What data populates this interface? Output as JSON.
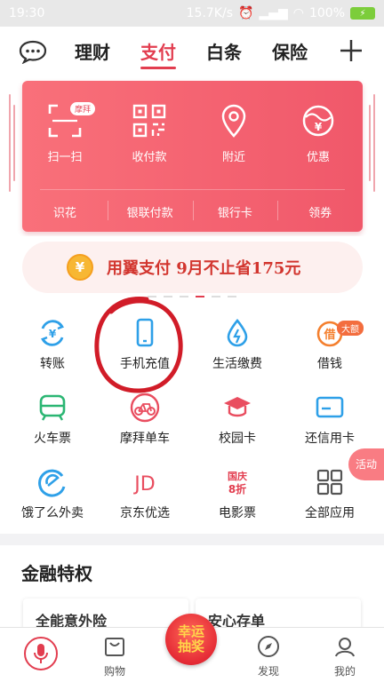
{
  "status_bar": {
    "time": "19:30",
    "network_speed": "15.7K/s",
    "battery": "100%"
  },
  "top_nav": {
    "tabs": [
      {
        "label": "理财",
        "active": false
      },
      {
        "label": "支付",
        "active": true
      },
      {
        "label": "白条",
        "active": false
      },
      {
        "label": "保险",
        "active": false
      }
    ]
  },
  "pay_card": {
    "actions": [
      {
        "label": "扫一扫",
        "icon": "scan-icon",
        "badge": "摩拜"
      },
      {
        "label": "收付款",
        "icon": "qrcode-icon"
      },
      {
        "label": "附近",
        "icon": "location-pin-icon"
      },
      {
        "label": "优惠",
        "icon": "coupon-yen-icon"
      }
    ],
    "sub_actions": [
      "识花",
      "银联付款",
      "银行卡",
      "领券"
    ]
  },
  "promo": {
    "coin_symbol": "¥",
    "text": "用翼支付 9月不止省175元"
  },
  "services": [
    {
      "label": "转账",
      "icon": "transfer-yen-icon",
      "color": "#2ea0e8"
    },
    {
      "label": "手机充值",
      "icon": "mobile-phone-icon",
      "color": "#2ea0e8"
    },
    {
      "label": "生活缴费",
      "icon": "water-drop-icon",
      "color": "#2ea0e8"
    },
    {
      "label": "借钱",
      "icon": "loan-jie-icon",
      "color": "#f47f2e",
      "badge": "大额"
    },
    {
      "label": "火车票",
      "icon": "train-icon",
      "color": "#2bb673"
    },
    {
      "label": "摩拜单车",
      "icon": "bicycle-icon",
      "color": "#e94d5f"
    },
    {
      "label": "校园卡",
      "icon": "graduation-cap-icon",
      "color": "#e94d5f"
    },
    {
      "label": "还信用卡",
      "icon": "credit-card-icon",
      "color": "#2ea0e8"
    },
    {
      "label": "饿了么外卖",
      "icon": "eleme-icon",
      "color": "#2ea0e8"
    },
    {
      "label": "京东优选",
      "icon": "jd-logo-icon",
      "color": "#e94d5f",
      "glyph": "JD"
    },
    {
      "label": "电影票",
      "icon": "national-day-discount-icon",
      "color": "#e23d4f",
      "glyph_top": "国庆",
      "glyph_bottom": "8折"
    },
    {
      "label": "全部应用",
      "icon": "all-apps-grid-icon",
      "color": "#555555"
    }
  ],
  "activity_tab": "活动",
  "finance_section": {
    "title": "金融特权",
    "cards": [
      "全能意外险",
      "安心存单"
    ]
  },
  "bottom_bar": {
    "items": [
      {
        "label": "",
        "icon": "microphone-icon"
      },
      {
        "label": "购物",
        "icon": "shopping-bag-icon"
      },
      {
        "label": "幸运抽奖",
        "icon": "lucky-draw-icon"
      },
      {
        "label": "发现",
        "icon": "compass-icon"
      },
      {
        "label": "我的",
        "icon": "user-icon"
      }
    ],
    "lottery_line1": "幸运",
    "lottery_line2": "抽奖"
  },
  "colors": {
    "accent": "#e23d4f",
    "card": "#f26272",
    "annotation": "#d11c28"
  }
}
